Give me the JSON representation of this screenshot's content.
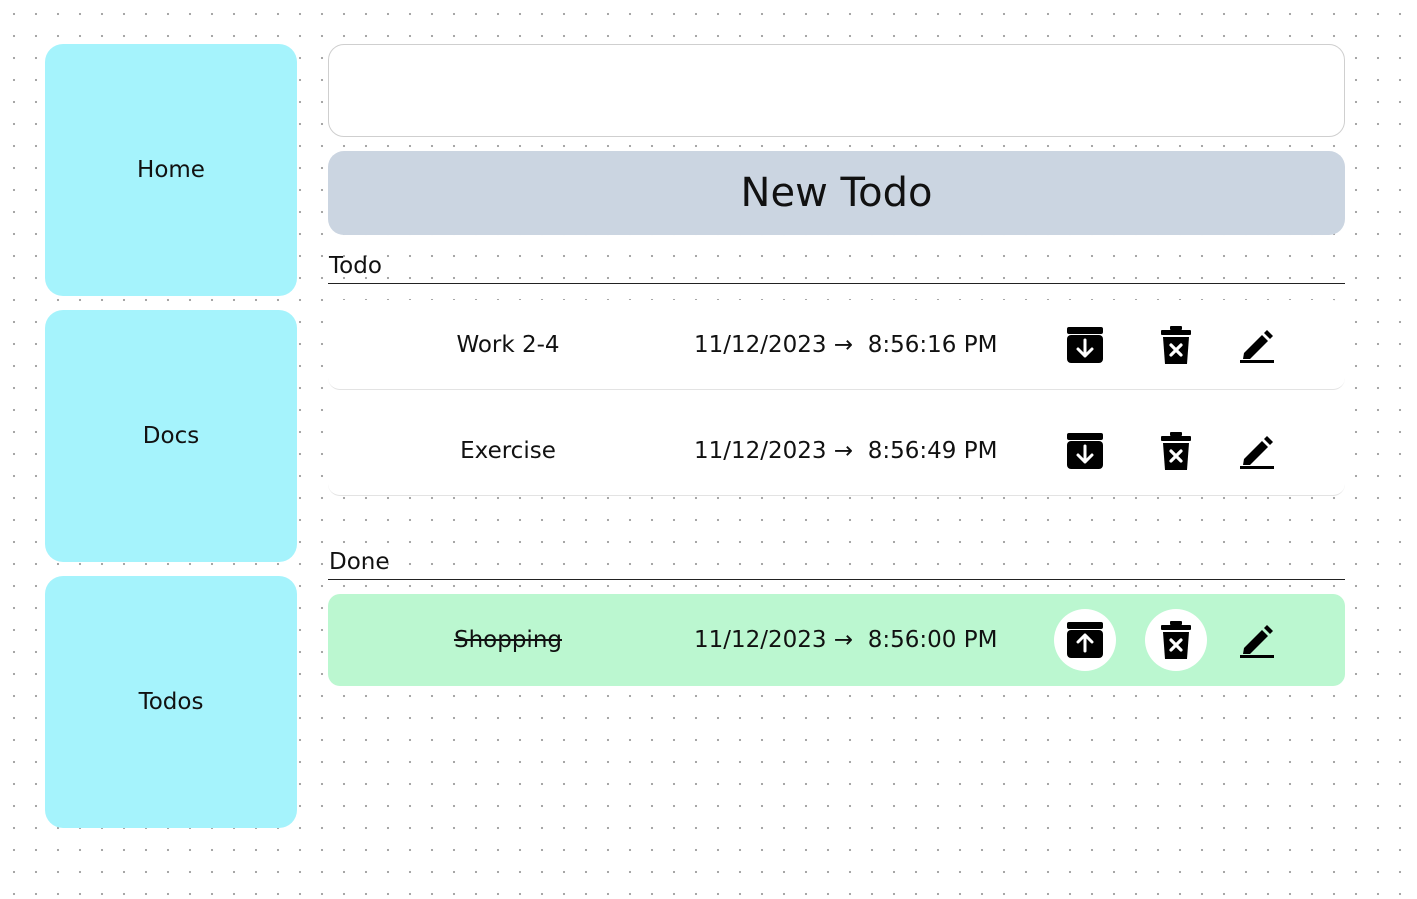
{
  "sidebar": {
    "items": [
      {
        "label": "Home"
      },
      {
        "label": "Docs"
      },
      {
        "label": "Todos"
      }
    ]
  },
  "new_todo": {
    "input_value": "",
    "input_placeholder": "",
    "button_label": "New Todo"
  },
  "sections": {
    "todo": {
      "title": "Todo",
      "items": [
        {
          "title": "Work 2-4",
          "datetime": "11/12/2023 →  8:56:16 PM",
          "icons": [
            "archive-down-icon",
            "trash-x-icon",
            "pencil-icon"
          ]
        },
        {
          "title": "Exercise",
          "datetime": "11/12/2023 →  8:56:49 PM",
          "icons": [
            "archive-down-icon",
            "trash-x-icon",
            "pencil-icon"
          ]
        }
      ]
    },
    "done": {
      "title": "Done",
      "items": [
        {
          "title": "Shopping",
          "datetime": "11/12/2023 →  8:56:00 PM",
          "icons": [
            "archive-up-icon",
            "trash-x-icon",
            "pencil-icon"
          ]
        }
      ]
    }
  },
  "colors": {
    "nav_card": "#a5f3fc",
    "new_todo_button": "#cbd5e1",
    "done_row": "#bbf7d0"
  }
}
